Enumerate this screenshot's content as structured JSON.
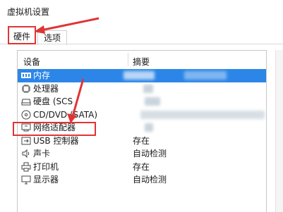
{
  "window": {
    "title": "虚拟机设置"
  },
  "tabs": [
    {
      "label": "硬件",
      "active": true
    },
    {
      "label": "选项",
      "active": false
    }
  ],
  "device_list": {
    "columns": {
      "device": "设备",
      "summary": "摘要"
    },
    "rows": [
      {
        "name": "内存",
        "icon": "memory-icon",
        "summary": "",
        "selected": true
      },
      {
        "name": "处理器",
        "icon": "cpu-icon",
        "summary": ""
      },
      {
        "name": "硬盘 (SCS",
        "icon": "hard-disk-icon",
        "summary": ""
      },
      {
        "name": "CD/DVD (SATA)",
        "icon": "cd-dvd-icon",
        "summary": ""
      },
      {
        "name": "网络适配器",
        "icon": "network-adapter-icon",
        "summary": "",
        "highlighted": true
      },
      {
        "name": "USB 控制器",
        "icon": "usb-icon",
        "summary": "存在"
      },
      {
        "name": "声卡",
        "icon": "speaker-icon",
        "summary": "自动检测"
      },
      {
        "name": "打印机",
        "icon": "printer-icon",
        "summary": "存在"
      },
      {
        "name": "显示器",
        "icon": "monitor-icon",
        "summary": "自动检测"
      }
    ]
  },
  "colors": {
    "selection": "#2c86e8",
    "annotation": "#e03434"
  }
}
